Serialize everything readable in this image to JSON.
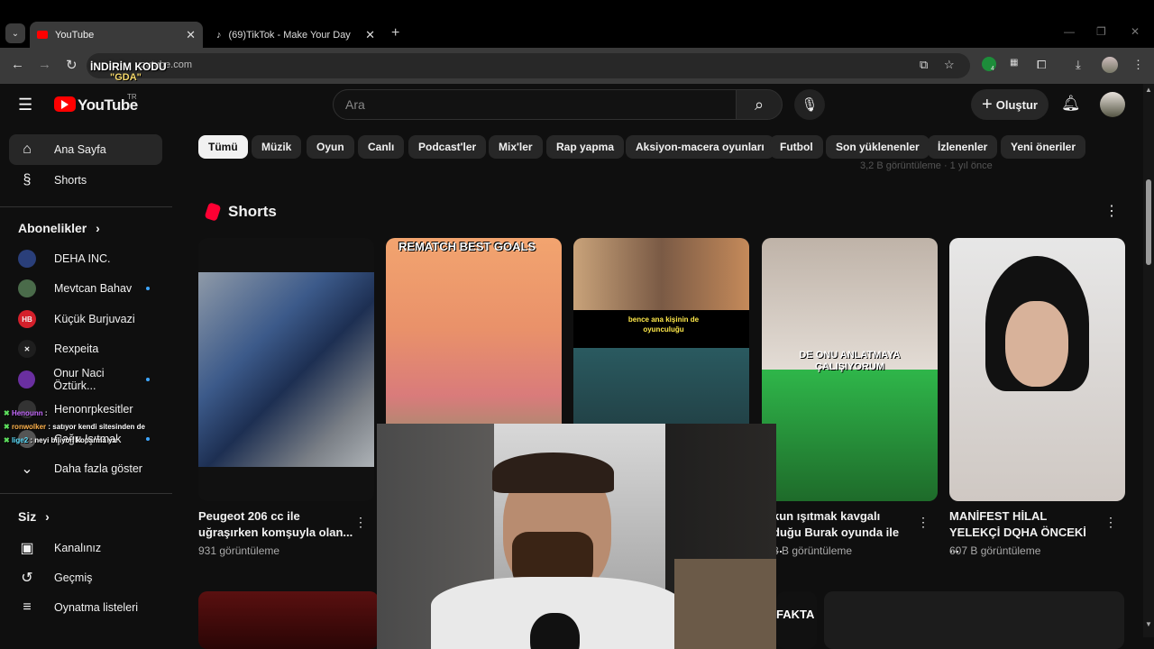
{
  "browser": {
    "tabs": [
      {
        "title": "YouTube",
        "active": true
      },
      {
        "title": "(69)TikTok - Make Your Day",
        "active": false
      }
    ],
    "url": "youtube.com",
    "extension_badge": "4"
  },
  "overlay": {
    "promo_line1": "İNDİRİM KODU",
    "promo_line2": "\"GDA\""
  },
  "header": {
    "logo_text": "YouTube",
    "country_code": "TR",
    "search_placeholder": "Ara",
    "create_label": "Oluştur"
  },
  "sidebar": {
    "main_items": [
      {
        "label": "Ana Sayfa"
      },
      {
        "label": "Shorts"
      }
    ],
    "subscriptions_heading": "Abonelikler",
    "subscriptions": [
      {
        "label": "DEHA INC.",
        "initials": "",
        "color": "#2a3f7a"
      },
      {
        "label": "Mevtcan Bahav",
        "initials": "",
        "color": "#4a6b4a"
      },
      {
        "label": "Küçük Burjuvazi",
        "initials": "HB",
        "color": "#d4202b"
      },
      {
        "label": "Rexpeita",
        "initials": "✕",
        "color": "#1e1e1e"
      },
      {
        "label": "Onur Naci Öztürk...",
        "initials": "",
        "color": "#6a2fa0"
      },
      {
        "label": "Henonrpkesitler",
        "initials": "",
        "color": "#333"
      },
      {
        "label": "Çağrı Işıtmak",
        "initials": "",
        "color": "#555"
      }
    ],
    "show_more": "Daha fazla göster",
    "you_heading": "Siz",
    "you_items": [
      {
        "label": "Kanalınız"
      },
      {
        "label": "Geçmiş"
      },
      {
        "label": "Oynatma listeleri"
      }
    ]
  },
  "chat": [
    {
      "user": "Henounn",
      "msg": ":"
    },
    {
      "user": "ronwolker",
      "msg": ": satıyor kendi sitesinden de"
    },
    {
      "user": "lige2",
      "msg": ": neyi biliyon koparma ya"
    }
  ],
  "chips": [
    "Tümü",
    "Müzik",
    "Oyun",
    "Canlı",
    "Podcast'ler",
    "Mix'ler",
    "Rap yapma",
    "Aksiyon-macera oyunları",
    "Futbol",
    "Son yüklenenler",
    "İzlenenler",
    "Yeni öneriler"
  ],
  "faint_text": "3,2 B görüntüleme · 1 yıl önce",
  "shorts": {
    "title": "Shorts",
    "cards": [
      {
        "title": "Peugeot 206 cc ile uğraşırken komşuyla olan...",
        "views": "931 görüntüleme",
        "thumb_text": ""
      },
      {
        "title": "",
        "views": "",
        "thumb_text": "REMATCH BEST GOALS"
      },
      {
        "title": "",
        "views": "",
        "thumb_text": "bence ana kişinin de oyunculuğu"
      },
      {
        "title": "kun ışıtmak kavgalı duğu Burak oyunda ile ...",
        "views": "3 B görüntüleme",
        "thumb_text": "DE ONU ANLATMAYA ÇALIŞIYORUM"
      },
      {
        "title": "MANİFEST HİLAL YELEKÇİ DQHA ÖNCEKİ ...",
        "views": "607 B görüntüleme",
        "thumb_text": ""
      }
    ]
  },
  "bottom_text": "FAKTA",
  "colors": {
    "brand": "#ff0000",
    "bg": "#0f0f0f",
    "chip": "#272727",
    "accent_dot": "#3ea6ff"
  }
}
